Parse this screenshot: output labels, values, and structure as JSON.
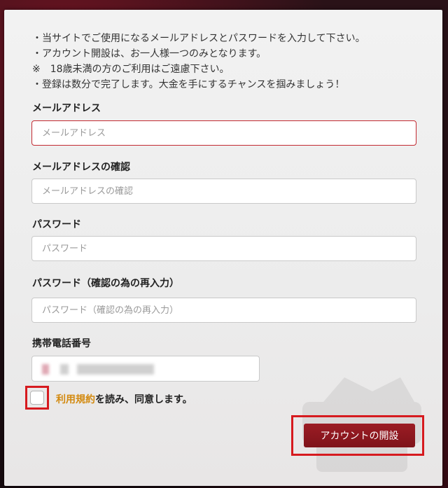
{
  "notes": [
    "・当サイトでご使用になるメールアドレスとパスワードを入力して下さい。",
    "・アカウント開設は、お一人様一つのみとなります。",
    "※　18歳未満の方のご利用はご遠慮下さい。",
    "・登録は数分で完了します。大金を手にするチャンスを掴みましょう！"
  ],
  "fields": {
    "email": {
      "label": "メールアドレス",
      "placeholder": "メールアドレス",
      "value": ""
    },
    "email_confirm": {
      "label": "メールアドレスの確認",
      "placeholder": "メールアドレスの確認",
      "value": ""
    },
    "password": {
      "label": "パスワード",
      "placeholder": "パスワード",
      "value": ""
    },
    "password_confirm": {
      "label": "パスワード（確認の為の再入力）",
      "placeholder": "パスワード（確認の為の再入力）",
      "value": ""
    },
    "phone": {
      "label": "携帯電話番号",
      "value_redacted": true
    }
  },
  "agreement": {
    "link_text": "利用規約",
    "suffix_text": "を読み、同意します。",
    "checked": false
  },
  "submit": {
    "label": "アカウントの開設"
  },
  "colors": {
    "accent_red": "#d61a1f",
    "button_red": "#8b1820",
    "link_orange": "#d38a10",
    "error_border": "#c22a32"
  }
}
